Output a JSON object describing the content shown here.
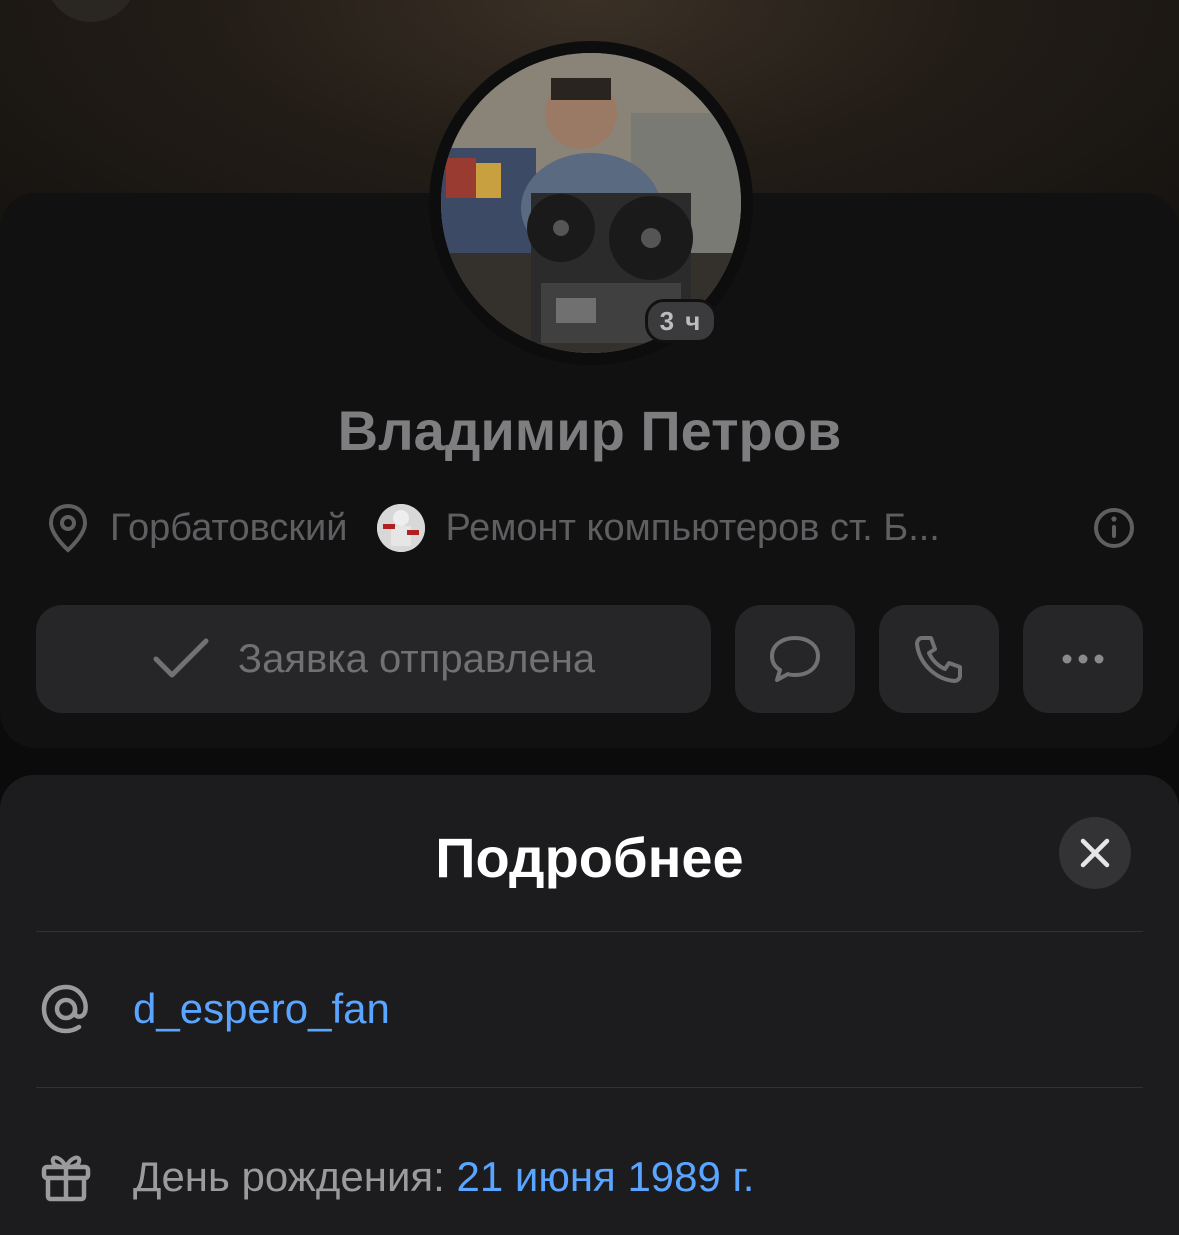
{
  "profile": {
    "name": "Владимир Петров",
    "story_age": "3 ч",
    "location": "Горбатовский",
    "group": "Ремонт компьютеров ст. Б...",
    "request_button": "Заявка отправлена"
  },
  "icons": {
    "pin": "location-pin-icon",
    "info": "info-icon",
    "check": "checkmark-icon",
    "message": "message-bubble-icon",
    "call": "phone-icon",
    "more": "more-dots-icon",
    "close": "close-icon",
    "at": "at-sign-icon",
    "gift": "gift-icon"
  },
  "sheet": {
    "title": "Подробнее",
    "username": "d_espero_fan",
    "birthday_label": "День рождения: ",
    "birthday_value": "21 июня 1989 г."
  },
  "colors": {
    "link": "#5aa5ff",
    "sheet_bg": "#1c1c1e",
    "button_bg": "#262628"
  }
}
